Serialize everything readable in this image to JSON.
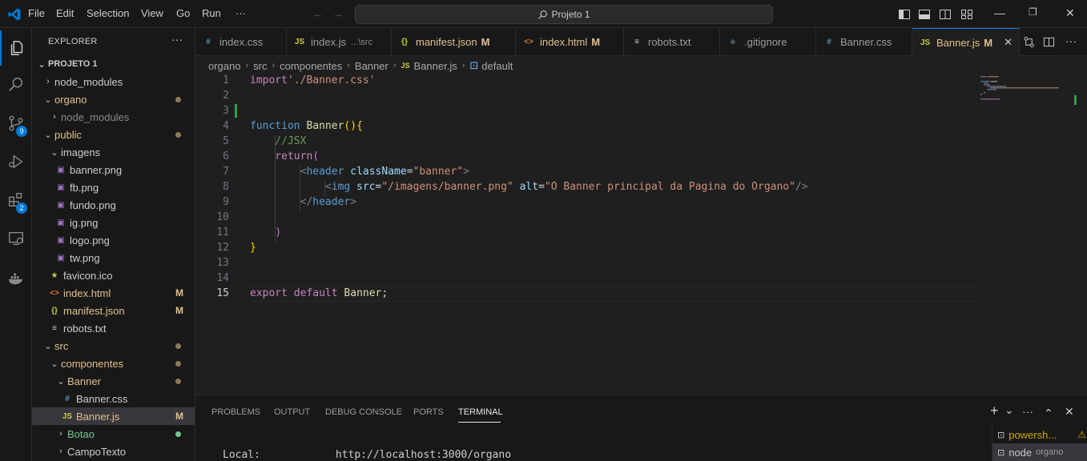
{
  "menu": [
    "File",
    "Edit",
    "Selection",
    "View",
    "Go",
    "Run",
    "···"
  ],
  "search": {
    "label": "Projeto 1",
    "icon": "search-icon"
  },
  "explorer": {
    "title": "EXPLORER",
    "more": "···",
    "root": "PROJETO 1",
    "tree": [
      {
        "label": "node_modules",
        "twist": "›",
        "icon": ""
      },
      {
        "label": "organo",
        "twist": "⌄",
        "icon": "",
        "status": "dot"
      },
      {
        "label": "node_modules",
        "twist": "›",
        "icon": ""
      },
      {
        "label": "public",
        "twist": "⌄",
        "icon": "",
        "status": "dot"
      },
      {
        "label": "imagens",
        "twist": "⌄",
        "icon": ""
      },
      {
        "label": "banner.png",
        "icon": "image-icon"
      },
      {
        "label": "fb.png",
        "icon": "image-icon"
      },
      {
        "label": "fundo.png",
        "icon": "image-icon"
      },
      {
        "label": "ig.png",
        "icon": "image-icon"
      },
      {
        "label": "logo.png",
        "icon": "image-icon"
      },
      {
        "label": "tw.png",
        "icon": "image-icon"
      },
      {
        "label": "favicon.ico",
        "icon": "star-icon"
      },
      {
        "label": "index.html",
        "icon": "html-icon",
        "status": "M"
      },
      {
        "label": "manifest.json",
        "icon": "json-icon",
        "status": "M"
      },
      {
        "label": "robots.txt",
        "icon": "text-file-icon"
      },
      {
        "label": "src",
        "twist": "⌄",
        "icon": "",
        "status": "dot"
      },
      {
        "label": "componentes",
        "twist": "⌄",
        "icon": "",
        "status": "dot"
      },
      {
        "label": "Banner",
        "twist": "⌄",
        "icon": "",
        "status": "dot"
      },
      {
        "label": "Banner.css",
        "icon": "css-icon"
      },
      {
        "label": "Banner.js",
        "icon": "js-icon",
        "status": "M"
      },
      {
        "label": "Botao",
        "twist": "›",
        "icon": "",
        "status": "dot-green"
      },
      {
        "label": "CampoTexto",
        "twist": "›",
        "icon": ""
      }
    ],
    "icon_glyphs": {
      "image-icon": "▣",
      "star-icon": "★",
      "html-icon": "<>",
      "json-icon": "{}",
      "text-file-icon": "≡",
      "css-icon": "#",
      "js-icon": "JS"
    },
    "modified_mark": "M"
  },
  "activity_badges": {
    "source_control": "9",
    "extensions": "2"
  },
  "tabs": [
    {
      "label": "index.css",
      "icon": "#",
      "desc": "",
      "mod": ""
    },
    {
      "label": "index.js",
      "icon": "JS",
      "desc": "...\\src",
      "mod": ""
    },
    {
      "label": "manifest.json",
      "icon": "{}",
      "desc": "",
      "mod": "M"
    },
    {
      "label": "index.html",
      "icon": "<>",
      "desc": "",
      "mod": "M"
    },
    {
      "label": "robots.txt",
      "icon": "≡",
      "desc": "",
      "mod": ""
    },
    {
      "label": ".gitignore",
      "icon": "◆",
      "desc": "",
      "mod": ""
    },
    {
      "label": "Banner.css",
      "icon": "#",
      "desc": "",
      "mod": ""
    },
    {
      "label": "Banner.js",
      "icon": "JS",
      "desc": "",
      "mod": "M",
      "active": true
    }
  ],
  "tab_close": "✕",
  "breadcrumbs": [
    "organo",
    "src",
    "componentes",
    "Banner",
    "Banner.js",
    "default"
  ],
  "breadcrumb_file_icon": "JS",
  "breadcrumb_symbol_icon": "⊡",
  "editor": {
    "current_line": 15,
    "lines": [
      {
        "n": "1",
        "tokens": [
          [
            "import",
            "k-purple"
          ],
          [
            "'./Banner.css'",
            "k-str"
          ]
        ]
      },
      {
        "n": "2",
        "tokens": []
      },
      {
        "n": "3",
        "tokens": []
      },
      {
        "n": "4",
        "tokens": [
          [
            "function ",
            "k-blue"
          ],
          [
            "Banner",
            "k-yellow"
          ],
          [
            "(){",
            "k-br1"
          ]
        ]
      },
      {
        "n": "5",
        "tokens": [
          [
            "    //JSX",
            "k-cmt"
          ]
        ]
      },
      {
        "n": "6",
        "tokens": [
          [
            "    return",
            "k-purple"
          ],
          [
            "(",
            "k-br2"
          ]
        ]
      },
      {
        "n": "7",
        "tokens": [
          [
            "        ",
            "k-def"
          ],
          [
            "<",
            "k-punc"
          ],
          [
            "header",
            "k-tag"
          ],
          [
            " className",
            "k-attr"
          ],
          [
            "=",
            "k-def"
          ],
          [
            "\"banner\"",
            "k-str"
          ],
          [
            ">",
            "k-punc"
          ]
        ]
      },
      {
        "n": "8",
        "tokens": [
          [
            "            ",
            "k-def"
          ],
          [
            "<",
            "k-punc"
          ],
          [
            "img",
            "k-tag"
          ],
          [
            " src",
            "k-attr"
          ],
          [
            "=",
            "k-def"
          ],
          [
            "\"/imagens/banner.png\"",
            "k-str"
          ],
          [
            " alt",
            "k-attr"
          ],
          [
            "=",
            "k-def"
          ],
          [
            "\"O Banner principal da Pagina do Organo\"",
            "k-str"
          ],
          [
            "/>",
            "k-punc"
          ]
        ]
      },
      {
        "n": "9",
        "tokens": [
          [
            "        ",
            "k-def"
          ],
          [
            "</",
            "k-punc"
          ],
          [
            "header",
            "k-tag"
          ],
          [
            ">",
            "k-punc"
          ]
        ]
      },
      {
        "n": "10",
        "tokens": []
      },
      {
        "n": "11",
        "tokens": [
          [
            "    ",
            "k-def"
          ],
          [
            ")",
            "k-br2"
          ]
        ]
      },
      {
        "n": "12",
        "tokens": [
          [
            "}",
            "k-br1"
          ]
        ]
      },
      {
        "n": "13",
        "tokens": []
      },
      {
        "n": "14",
        "tokens": []
      },
      {
        "n": "15",
        "tokens": [
          [
            "export ",
            "k-purple"
          ],
          [
            "default ",
            "k-purple"
          ],
          [
            "Banner",
            "k-yellow"
          ],
          [
            ";",
            "k-def"
          ]
        ]
      }
    ]
  },
  "panel": {
    "tabs": [
      "PROBLEMS",
      "OUTPUT",
      "DEBUG CONSOLE",
      "PORTS",
      "TERMINAL"
    ],
    "active_tab": "TERMINAL",
    "terminal_line": "Local:            http://localhost:3000/organo",
    "terminals": [
      {
        "label": "powersh...",
        "sub": "",
        "warn": "⚠"
      },
      {
        "label": "node",
        "sub": "organo",
        "warn": ""
      }
    ],
    "actions": {
      "add": "+",
      "dropdown": "⌄",
      "more": "···",
      "maximize": "⌃",
      "close": "✕"
    }
  },
  "colors": {
    "accent": "#0078d4",
    "modified": "#e2c08d",
    "untracked_dot": "#73c991",
    "html_icon": "#e37933",
    "json_icon": "#cbcb41",
    "css_icon": "#519aba",
    "js_icon": "#cbcb41",
    "image_icon": "#a074c4"
  }
}
